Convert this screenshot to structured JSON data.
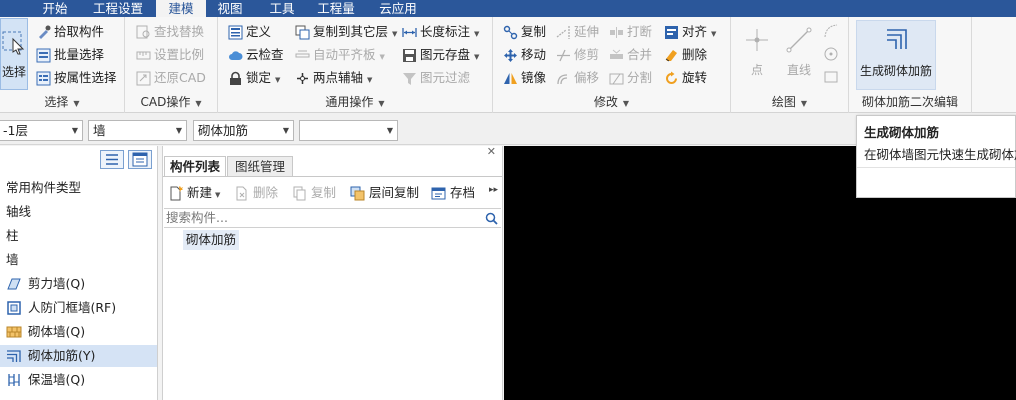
{
  "colors": {
    "menubar": "#2b579a",
    "selected_row": "#d5e3f5",
    "canvas": "#000000"
  },
  "menu": {
    "tabs": [
      {
        "label": "开始"
      },
      {
        "label": "工程设置"
      },
      {
        "label": "建模",
        "active": true
      },
      {
        "label": "视图"
      },
      {
        "label": "工具"
      },
      {
        "label": "工程量"
      },
      {
        "label": "云应用"
      }
    ]
  },
  "ribbon": {
    "select_group": {
      "label": "选择",
      "big_select": "选择",
      "pick_component": "拾取构件",
      "batch_select": "批量选择",
      "select_by_attr": "按属性选择"
    },
    "cad_group": {
      "label": "CAD操作",
      "find_replace": "查找替换",
      "set_scale": "设置比例",
      "restore_cad": "还原CAD"
    },
    "common_group": {
      "label": "通用操作",
      "define": "定义",
      "cloud_check": "云检查",
      "lock": "锁定",
      "copy_to_other_floor": "复制到其它层",
      "auto_align_slab": "自动平齐板",
      "two_point_axis": "两点辅轴",
      "length_dimension": "长度标注",
      "element_save": "图元存盘",
      "element_filter": "图元过滤"
    },
    "modify_group": {
      "label": "修改",
      "copy": "复制",
      "move": "移动",
      "mirror": "镜像",
      "extend": "延伸",
      "trim": "修剪",
      "offset": "偏移",
      "break": "打断",
      "merge": "合并",
      "split": "分割",
      "align": "对齐",
      "delete": "删除",
      "rotate": "旋转"
    },
    "draw_group": {
      "label": "绘图",
      "point": "点",
      "line": "直线"
    },
    "masonry_group": {
      "label": "砌体加筋二次编辑",
      "generate_button": "生成砌体加筋"
    }
  },
  "selectors": {
    "floor": "-1层",
    "category": "墙",
    "type": "砌体加筋",
    "component": ""
  },
  "tree": {
    "items": [
      {
        "label": "常用构件类型",
        "icon": "none"
      },
      {
        "label": "轴线",
        "icon": "none"
      },
      {
        "label": "柱",
        "icon": "none"
      },
      {
        "label": "墙",
        "icon": "none"
      },
      {
        "label": "剪力墙(Q)",
        "icon": "shear-wall-icon"
      },
      {
        "label": "人防门框墙(RF)",
        "icon": "civil-defense-wall-icon"
      },
      {
        "label": "砌体墙(Q)",
        "icon": "masonry-wall-icon"
      },
      {
        "label": "砌体加筋(Y)",
        "icon": "masonry-rebar-icon",
        "selected": true
      },
      {
        "label": "保温墙(Q)",
        "icon": "insulation-wall-icon"
      }
    ]
  },
  "component_panel": {
    "tabs": [
      {
        "label": "构件列表",
        "active": true
      },
      {
        "label": "图纸管理"
      }
    ],
    "toolbar": {
      "new": "新建",
      "delete": "删除",
      "copy": "复制",
      "floor_copy": "层间复制",
      "archive": "存档"
    },
    "search_placeholder": "搜索构件...",
    "items": [
      "砌体加筋"
    ]
  },
  "tooltip": {
    "title": "生成砌体加筋",
    "description": "在砌体墙图元快速生成砌体加"
  }
}
